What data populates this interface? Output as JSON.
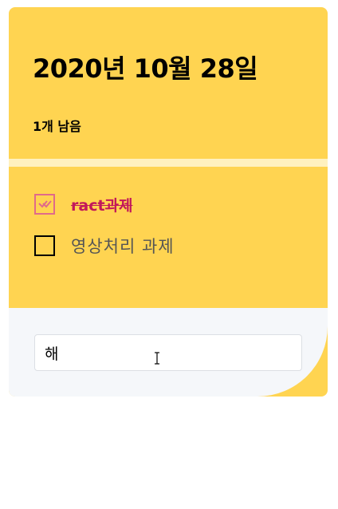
{
  "header": {
    "date": "2020년 10월 28일",
    "remaining": "1개 남음"
  },
  "todos": [
    {
      "text": "ract과제",
      "done": true
    },
    {
      "text": "영상처리 과제",
      "done": false
    }
  ],
  "input": {
    "value": "해"
  },
  "colors": {
    "accent": "#ffd451",
    "divider": "#fff1bf",
    "check": "#e06a8a",
    "done_text": "#c2185b",
    "input_bg": "#f5f7fa"
  }
}
